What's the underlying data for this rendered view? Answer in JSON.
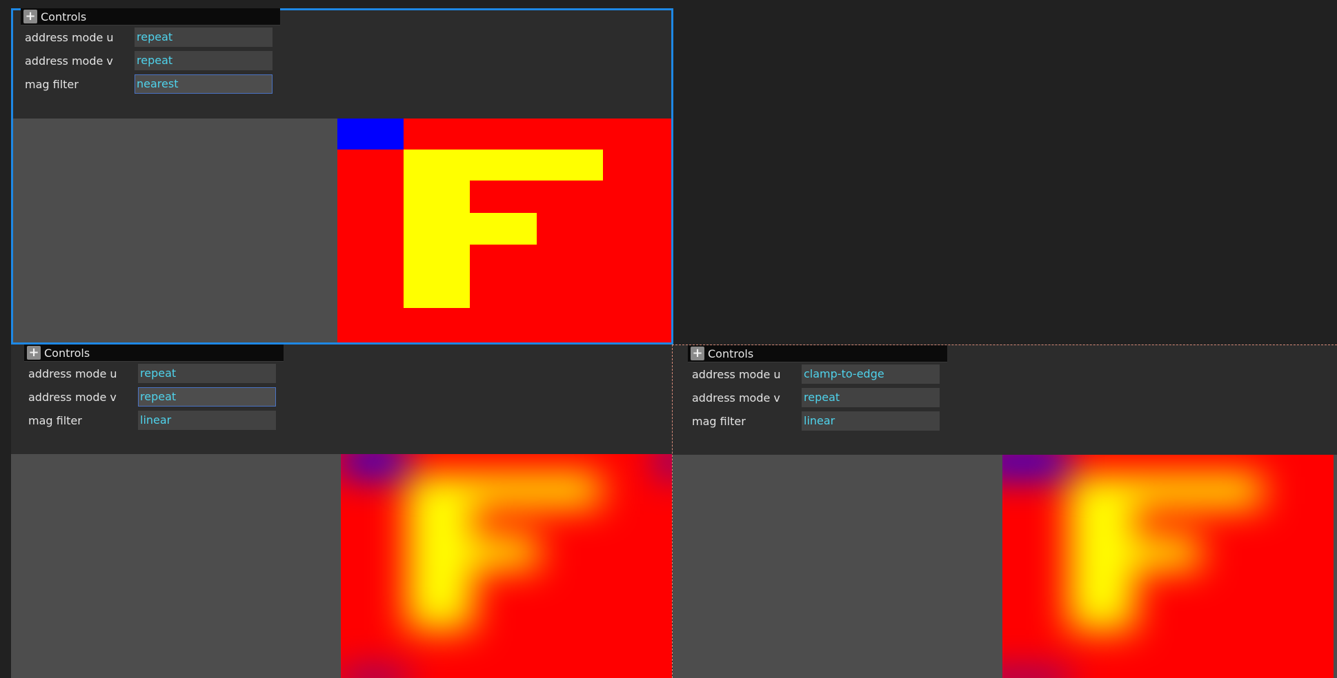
{
  "panels": [
    {
      "controls_title": "Controls",
      "rows": [
        {
          "label": "address mode u",
          "value": "repeat"
        },
        {
          "label": "address mode v",
          "value": "repeat"
        },
        {
          "label": "mag filter",
          "value": "nearest"
        }
      ]
    },
    {
      "controls_title": "Controls",
      "rows": [
        {
          "label": "address mode u",
          "value": "repeat"
        },
        {
          "label": "address mode v",
          "value": "repeat"
        },
        {
          "label": "mag filter",
          "value": "linear"
        }
      ]
    },
    {
      "controls_title": "Controls",
      "rows": [
        {
          "label": "address mode u",
          "value": "clamp-to-edge"
        },
        {
          "label": "address mode v",
          "value": "repeat"
        },
        {
          "label": "mag filter",
          "value": "linear"
        }
      ]
    }
  ],
  "colors": {
    "background": "#212121",
    "panel": "#2c2c2c",
    "selection_outline": "#1e88e5",
    "dashed_border": "#d98c7a",
    "texture_red": "#ff0000",
    "texture_yellow": "#ffff00",
    "texture_blue": "#0000ff",
    "value_text": "#4fd3ec"
  },
  "icons": {
    "expand": "plus-icon"
  }
}
